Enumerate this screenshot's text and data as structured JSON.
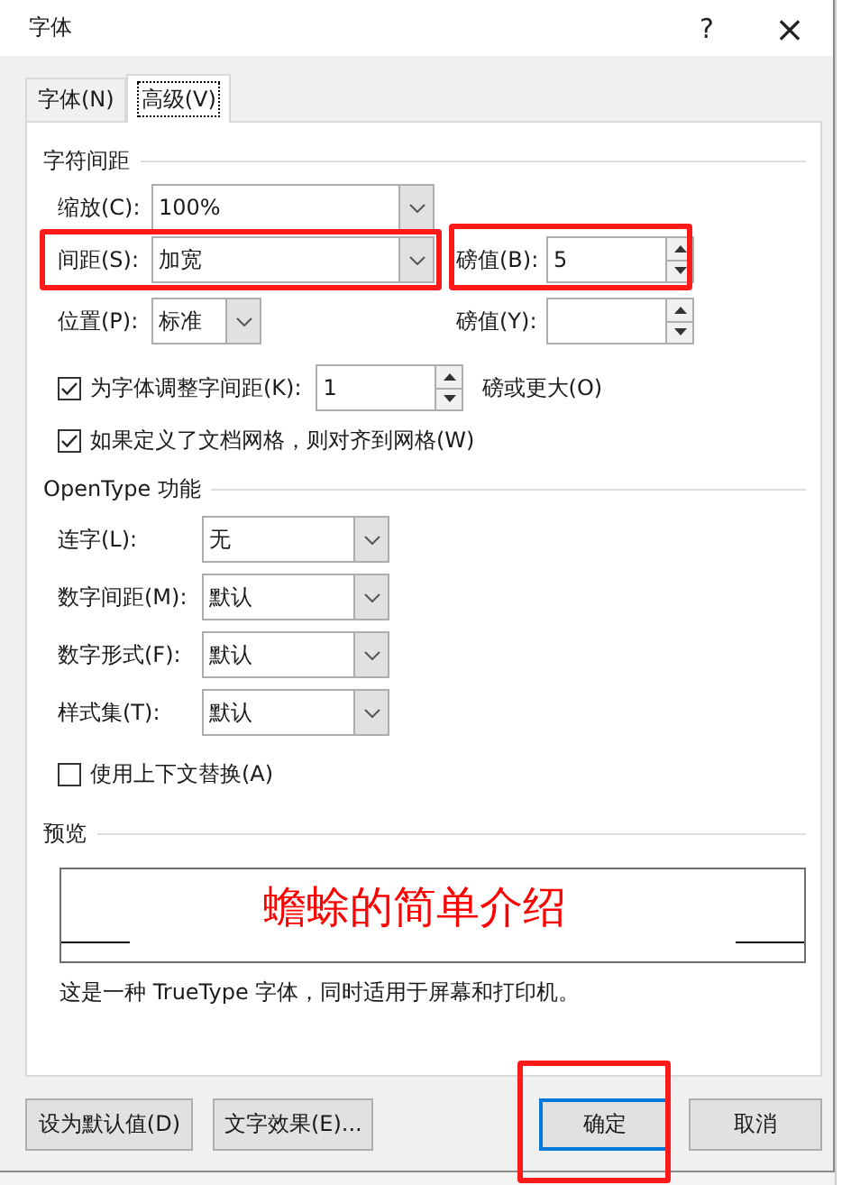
{
  "window": {
    "title": "字体",
    "help": "?",
    "close": "×"
  },
  "tabs": [
    {
      "label": "字体(N)",
      "selected": false
    },
    {
      "label": "高级(V)",
      "selected": true
    }
  ],
  "character_spacing": {
    "heading": "字符间距",
    "scale": {
      "label": "缩放(C):",
      "value": "100%"
    },
    "spacing": {
      "label": "间距(S):",
      "value": "加宽",
      "highlighted": true
    },
    "spacing_by": {
      "label": "磅值(B):",
      "value": "5",
      "highlighted": true
    },
    "position": {
      "label": "位置(P):",
      "value": "标准"
    },
    "position_by": {
      "label": "磅值(Y):"
    },
    "kerning": {
      "label": "为字体调整字间距(K):",
      "checked": true,
      "value": "1",
      "suffix": "磅或更大(O)"
    },
    "snap_to_grid": {
      "label": "如果定义了文档网格，则对齐到网格(W)",
      "checked": true
    }
  },
  "opentype": {
    "heading": "OpenType 功能",
    "selects": [
      {
        "label": "连字(L):",
        "value": "无"
      },
      {
        "label": "数字间距(M):",
        "value": "默认"
      },
      {
        "label": "数字形式(F):",
        "value": "默认"
      },
      {
        "label": "样式集(T):",
        "value": "默认"
      }
    ],
    "contextual_alternates": {
      "label": "使用上下文替换(A)",
      "checked": false
    }
  },
  "preview": {
    "heading": "预览",
    "sample": "蟾蜍的简单介绍",
    "description": "这是一种 TrueType 字体，同时适用于屏幕和打印机。"
  },
  "buttons": [
    {
      "label": "设为默认值(D)",
      "default": false,
      "highlighted": false
    },
    {
      "label": "文字效果(E)...",
      "default": false,
      "highlighted": false
    },
    {
      "label": "确定",
      "default": true,
      "highlighted": true
    },
    {
      "label": "取消",
      "default": false,
      "highlighted": false
    }
  ]
}
